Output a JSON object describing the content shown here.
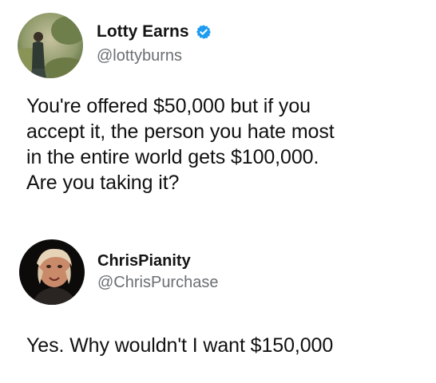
{
  "tweets": [
    {
      "display_name": "Lotty Earns",
      "verified": true,
      "handle": "@lottyburns",
      "text_lines": [
        "You're offered $50,000 but if you",
        "accept it, the person you hate most",
        "in the entire world gets $100,000.",
        "Are you taking it?"
      ]
    },
    {
      "display_name": "ChrisPianity",
      "verified": false,
      "handle": "@ChrisPurchase",
      "text_lines": [
        "Yes. Why wouldn't I want $150,000"
      ]
    }
  ],
  "colors": {
    "verified_badge": "#1d9bf0",
    "handle_gray": "#6b6f73",
    "text": "#111111"
  }
}
